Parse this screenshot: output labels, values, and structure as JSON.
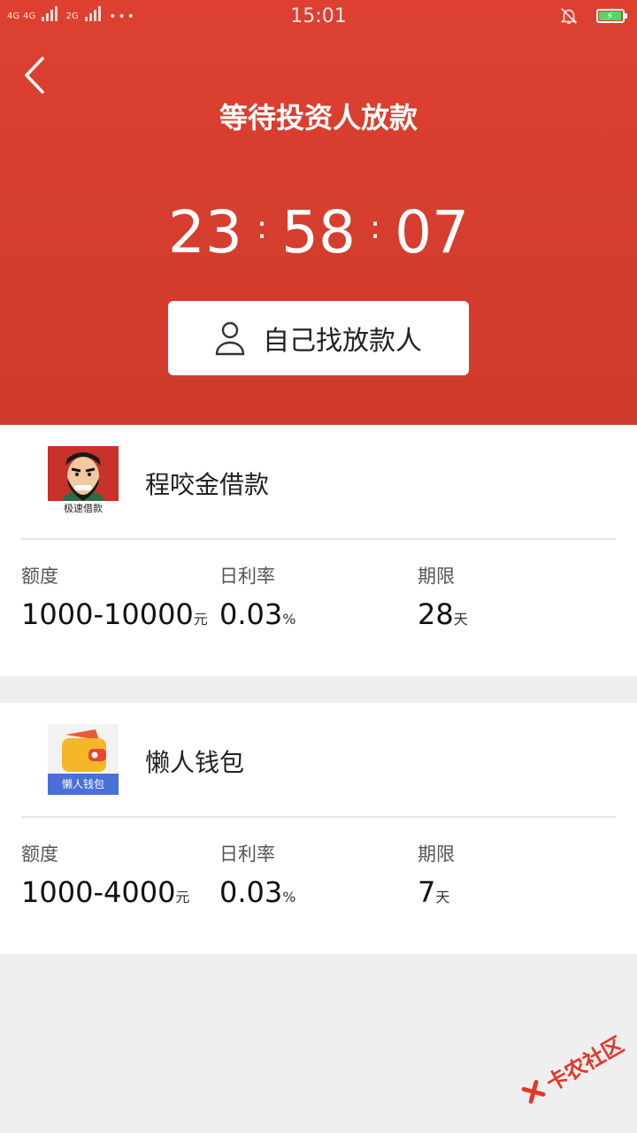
{
  "status_bar": {
    "net1": "4G",
    "net2": "4G",
    "net3": "2G",
    "more": "•••",
    "time": "15:01"
  },
  "header": {
    "title": "等待投资人放款",
    "countdown": {
      "hours": "23",
      "minutes": "58",
      "seconds": "07",
      "separator": ":"
    },
    "find_button": "自己找放款人"
  },
  "products": [
    {
      "name": "程咬金借款",
      "logo_caption": "极速借款",
      "amount_label": "额度",
      "amount_value": "1000-10000",
      "amount_unit": "元",
      "rate_label": "日利率",
      "rate_value": "0.03",
      "rate_unit": "%",
      "term_label": "期限",
      "term_value": "28",
      "term_unit": "天"
    },
    {
      "name": "懒人钱包",
      "logo_caption": "懒人钱包",
      "amount_label": "额度",
      "amount_value": "1000-4000",
      "amount_unit": "元",
      "rate_label": "日利率",
      "rate_value": "0.03",
      "rate_unit": "%",
      "term_label": "期限",
      "term_value": "7",
      "term_unit": "天"
    }
  ],
  "watermark": "卡农社区",
  "colors": {
    "header_red": "#d63f2f",
    "battery_green": "#4cd964"
  }
}
